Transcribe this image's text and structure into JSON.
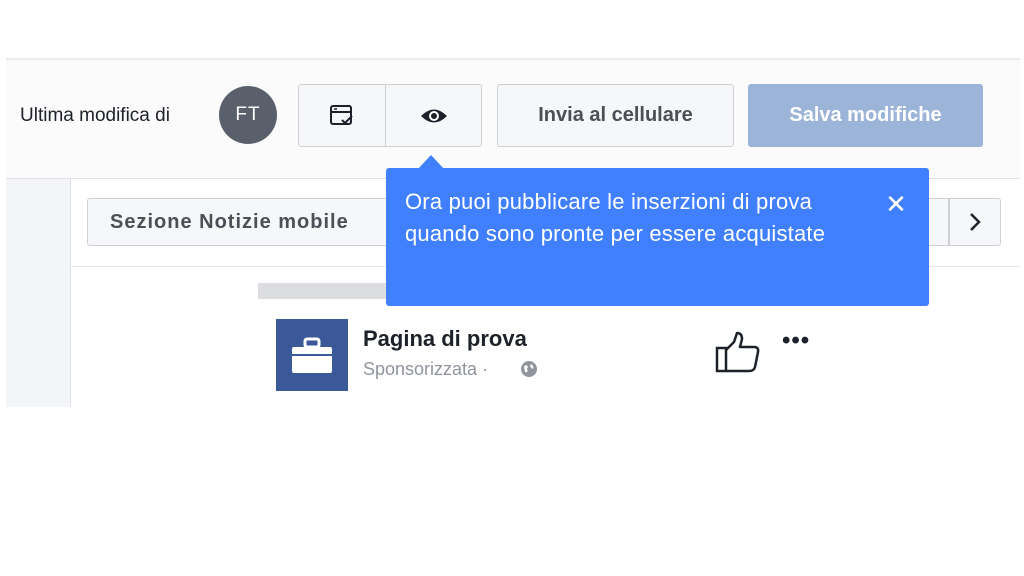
{
  "header": {
    "last_edit_label": "Ultima modifica di",
    "avatar_initials": "FT",
    "send_to_mobile_label": "Invia al cellulare",
    "save_changes_label": "Salva modifiche",
    "layout_icon": "ad-layout-check-icon",
    "preview_icon": "eye-icon"
  },
  "preview": {
    "placement_label": "Sezione Notizie mobile",
    "next_icon": "chevron-right-icon",
    "page_name": "Pagina di prova",
    "sponsored_label": "Sponsorizzata ·",
    "page_logo_icon": "briefcase-icon",
    "globe_icon": "globe-icon",
    "like_icon": "thumbs-up-icon",
    "more_icon": "more-horizontal-icon",
    "more_glyph": "•••"
  },
  "tooltip": {
    "text": "Ora puoi pubblicare le inserzioni di prova quando sono pronte per essere acquistate",
    "close_glyph": "✕",
    "color": "#4080ff"
  },
  "colors": {
    "save_button_disabled": "#9cb4d8",
    "page_logo": "#3b5998",
    "avatar": "#59606b"
  }
}
